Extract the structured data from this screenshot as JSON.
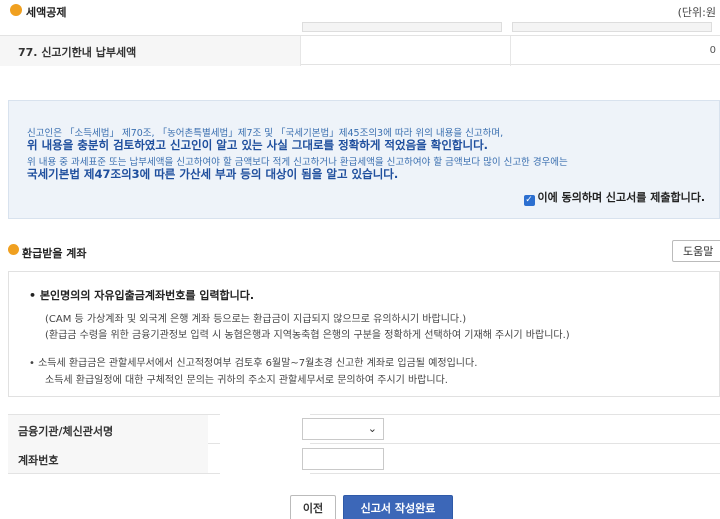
{
  "tax_credit_section": {
    "icon": "circle-bullet-icon",
    "title": "세액공제",
    "unit": "(단위:원"
  },
  "row_77": {
    "label": "77. 신고기한내 납부세액",
    "value": "0"
  },
  "declaration": {
    "line1": "신고인은 「소득세법」 제70조, 「농어촌특별세법」제7조 및 「국세기본법」제45조의3에 따라 위의 내용을 신고하며,",
    "line2": "위 내용을 충분히 검토하였고 신고인이 알고 있는 사실 그대로를 정확하게 적었음을 확인합니다.",
    "line3": "위 내용 중 과세표준 또는 납부세액을 신고하여야 할 금액보다 적게 신고하거나 환급세액을 신고하여야 할 금액보다 많이 신고한 경우에는",
    "line4": "국세기본법 제47조의3에 따른 가산세 부과 등의 대상이 됨을 알고 있습니다.",
    "agree_checked": true,
    "agree_label": "이에 동의하며 신고서를 제출합니다."
  },
  "refund_account": {
    "title": "환급받을 계좌",
    "help_label": "도움말",
    "notice": {
      "heading": "• 본인명의의 자유입출금계좌번호를 입력합니다.",
      "line1": "(CAM 등 가상계좌 및 외국계 은행 계좌 등으로는 환급금이 지급되지 않으므로 유의하시기 바랍니다.)",
      "line2": "(환급금 수령을 위한 금융기관정보 입력 시 농협은행과 지역농축협 은행의 구분을 정확하게 선택하여 기재해 주시기 바랍니다.)",
      "line3": "• 소득세 환급금은 관할세무서에서 신고적정여부 검토후 6월말~7월초경 신고한 계좌로 입금될 예정입니다.",
      "line4": "소득세 환급일정에 대한 구체적인 문의는 귀하의 주소지 관할세무서로 문의하여 주시기 바랍니다."
    },
    "bank_label": "금융기관/체신관서명",
    "bank_selected": "",
    "account_label": "계좌번호",
    "account_value": ""
  },
  "buttons": {
    "prev": "이전",
    "submit": "신고서 작성완료"
  },
  "colors": {
    "accent_blue": "#3c67b8",
    "declare_text": "#1f4f9e",
    "bullet_orange": "#f0a020"
  }
}
